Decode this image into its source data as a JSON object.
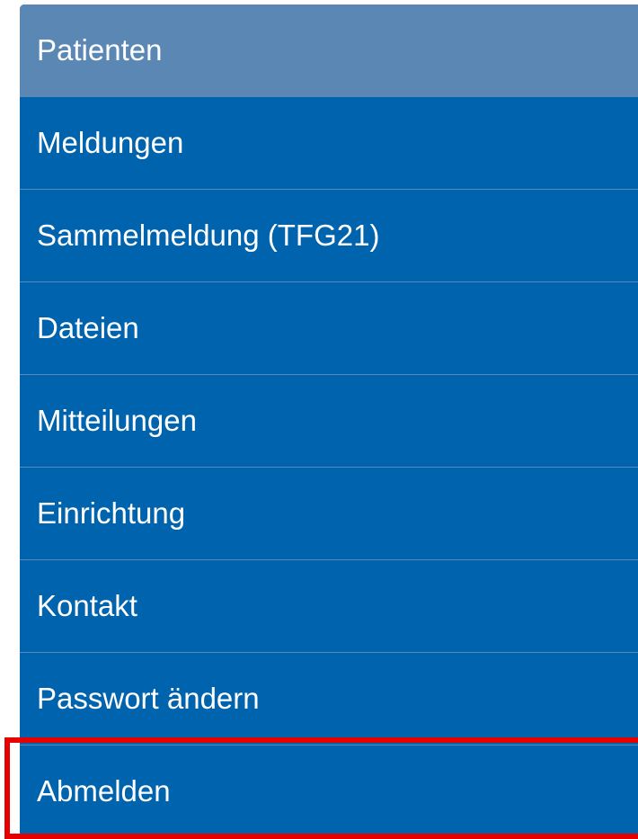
{
  "menu": {
    "items": [
      {
        "label": "Patienten",
        "active": true
      },
      {
        "label": "Meldungen",
        "active": false
      },
      {
        "label": "Sammelmeldung (TFG21)",
        "active": false
      },
      {
        "label": "Dateien",
        "active": false
      },
      {
        "label": "Mitteilungen",
        "active": false
      },
      {
        "label": "Einrichtung",
        "active": false
      },
      {
        "label": "Kontakt",
        "active": false
      },
      {
        "label": "Passwort ändern",
        "active": false
      },
      {
        "label": "Abmelden",
        "active": false
      }
    ]
  },
  "colors": {
    "menu_background": "#0063ad",
    "active_background": "#5a87b4",
    "divider": "#5a89ba",
    "text": "#ffffff",
    "highlight": "#e60000"
  }
}
